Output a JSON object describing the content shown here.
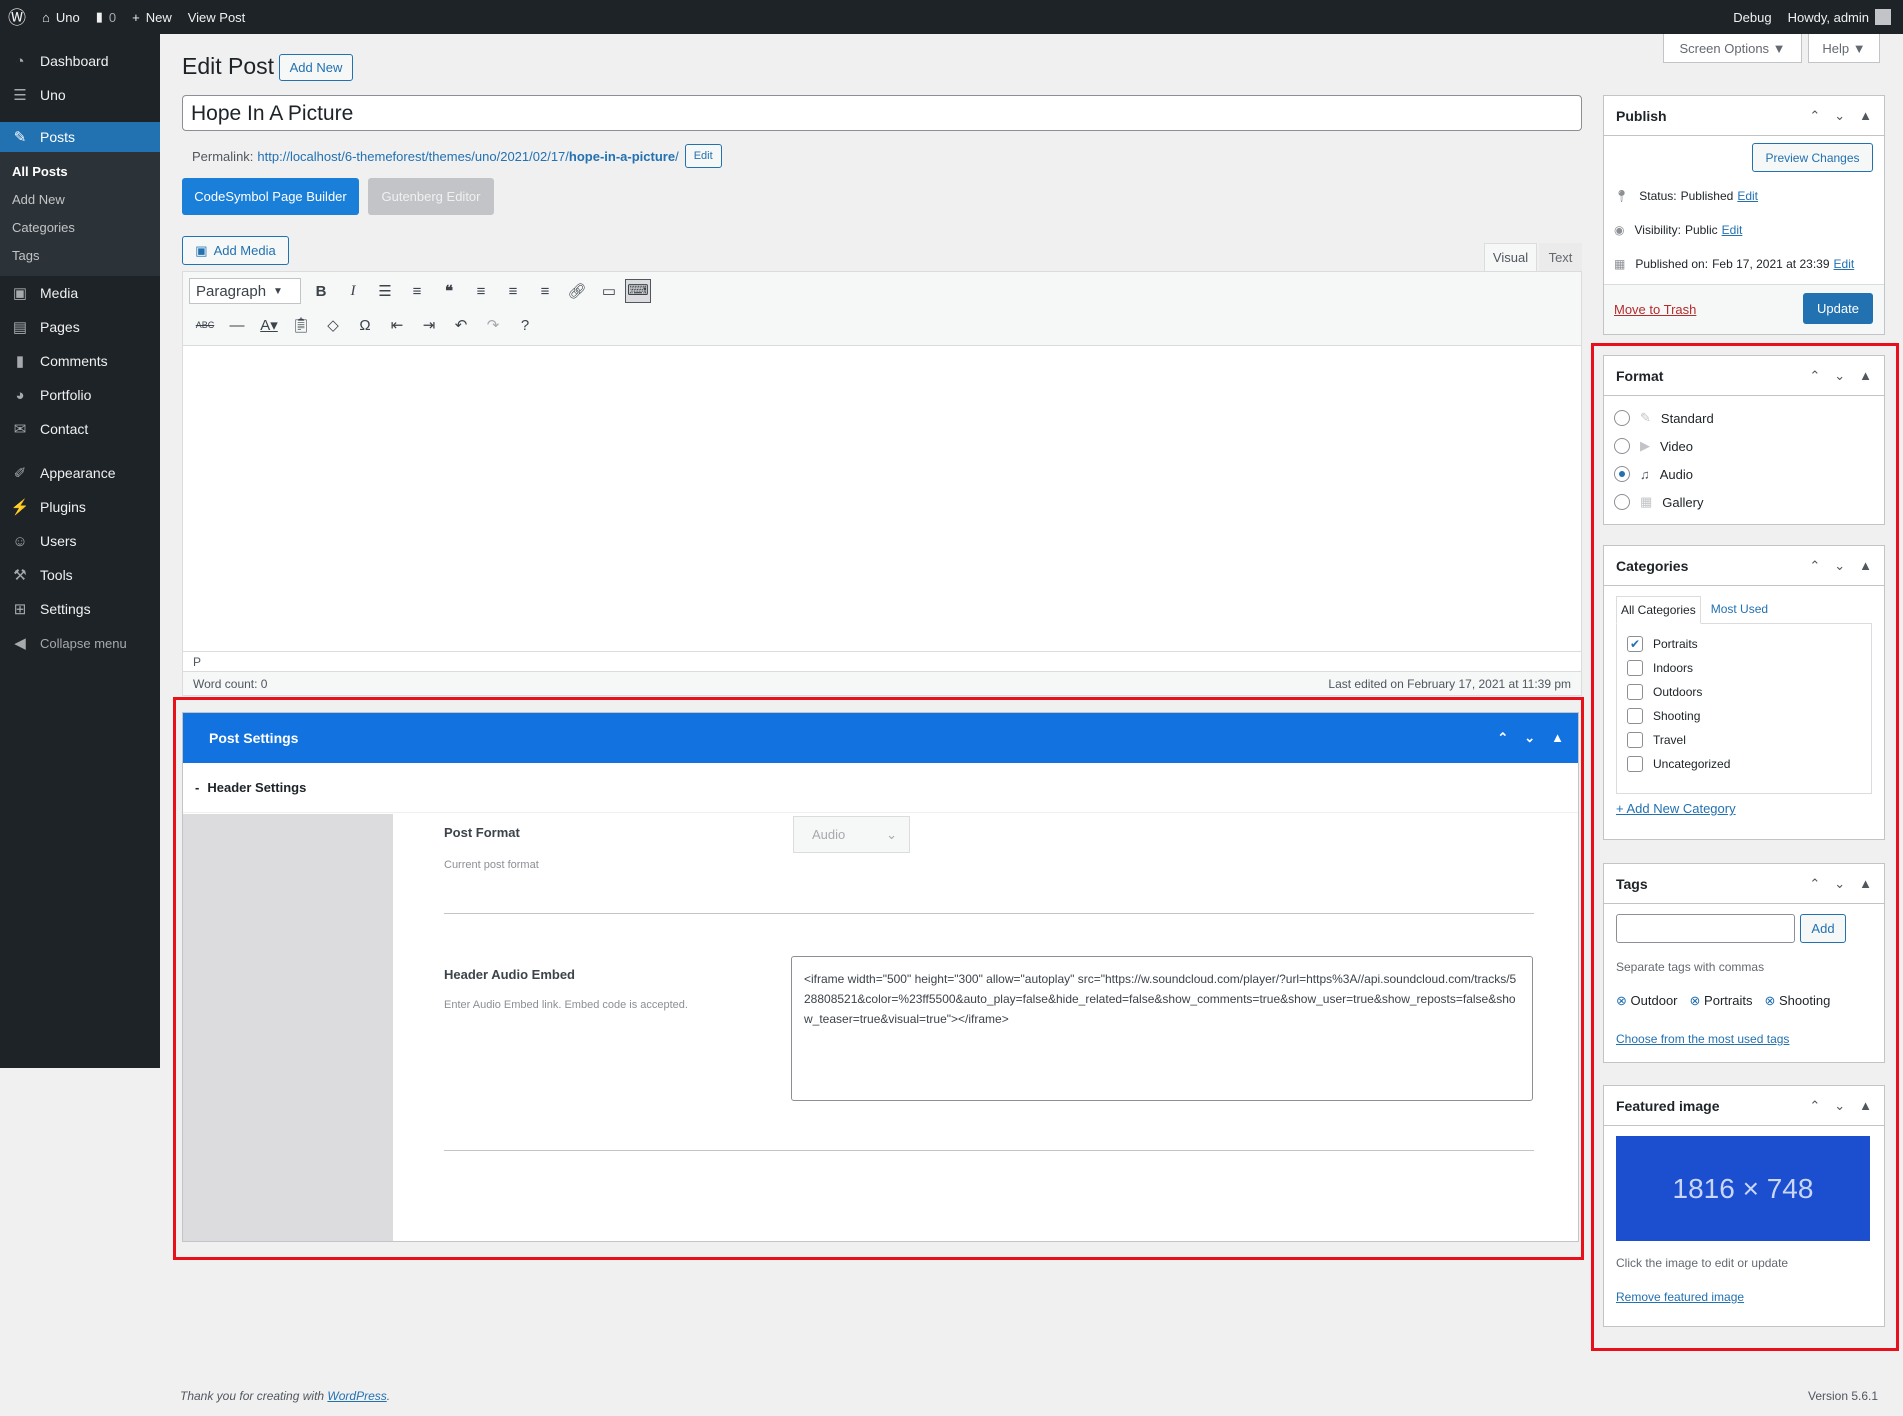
{
  "adminbar": {
    "site": "Uno",
    "comments": "0",
    "new": "New",
    "view": "View Post",
    "debug": "Debug",
    "howdy": "Howdy, admin"
  },
  "menu": {
    "items": [
      {
        "label": "Dashboard",
        "icon": "dashboard-icon"
      },
      {
        "label": "Uno",
        "icon": "uno-icon"
      },
      {
        "label": "Posts",
        "icon": "pin-icon"
      }
    ],
    "sub": [
      "All Posts",
      "Add New",
      "Categories",
      "Tags"
    ],
    "items2": [
      {
        "label": "Media"
      },
      {
        "label": "Pages"
      },
      {
        "label": "Comments"
      },
      {
        "label": "Portfolio"
      },
      {
        "label": "Contact"
      }
    ],
    "items3": [
      {
        "label": "Appearance"
      },
      {
        "label": "Plugins"
      },
      {
        "label": "Users"
      },
      {
        "label": "Tools"
      },
      {
        "label": "Settings"
      }
    ],
    "collapse": "Collapse menu"
  },
  "top": {
    "screen_options": "Screen Options ▼",
    "help": "Help ▼"
  },
  "page": {
    "title": "Edit Post",
    "add_new": "Add New"
  },
  "post": {
    "title": "Hope In A Picture",
    "permalink_label": "Permalink:",
    "permalink_base": "http://localhost/6-themeforest/themes/uno/2021/02/17/",
    "permalink_slug": "hope-in-a-picture",
    "permalink_tail": "/",
    "edit": "Edit"
  },
  "builders": {
    "codesymbol": "CodeSymbol Page Builder",
    "gutenberg": "Gutenberg Editor"
  },
  "editor": {
    "add_media": "Add Media",
    "tab_visual": "Visual",
    "tab_text": "Text",
    "format": "Paragraph",
    "path": "P",
    "word_count": "Word count: 0",
    "last_edited": "Last edited on February 17, 2021 at 11:39 pm"
  },
  "post_settings": {
    "title": "Post Settings",
    "header_settings": "Header Settings",
    "post_format_label": "Post Format",
    "post_format_desc": "Current post format",
    "post_format_value": "Audio",
    "audio_label": "Header Audio Embed",
    "audio_desc": "Enter Audio Embed link. Embed code is accepted.",
    "audio_value": "<iframe width=\"500\" height=\"300\" allow=\"autoplay\" src=\"https://w.soundcloud.com/player/?url=https%3A//api.soundcloud.com/tracks/528808521&color=%23ff5500&auto_play=false&hide_related=false&show_comments=true&show_user=true&show_reposts=false&show_teaser=true&visual=true\"></iframe>"
  },
  "publish": {
    "title": "Publish",
    "preview": "Preview Changes",
    "status_label": "Status:",
    "status": "Published",
    "visibility_label": "Visibility:",
    "visibility": "Public",
    "published_label": "Published on:",
    "published": "Feb 17, 2021 at 23:39",
    "edit": "Edit",
    "trash": "Move to Trash",
    "update": "Update"
  },
  "format": {
    "title": "Format",
    "options": [
      "Standard",
      "Video",
      "Audio",
      "Gallery"
    ],
    "selected": "Audio"
  },
  "categories": {
    "title": "Categories",
    "tab_all": "All Categories",
    "tab_most": "Most Used",
    "items": [
      {
        "label": "Portraits",
        "checked": true
      },
      {
        "label": "Indoors",
        "checked": false
      },
      {
        "label": "Outdoors",
        "checked": false
      },
      {
        "label": "Shooting",
        "checked": false
      },
      {
        "label": "Travel",
        "checked": false
      },
      {
        "label": "Uncategorized",
        "checked": false
      }
    ],
    "add": "+ Add New Category"
  },
  "tags": {
    "title": "Tags",
    "add": "Add",
    "hint": "Separate tags with commas",
    "items": [
      "Outdoor",
      "Portraits",
      "Shooting"
    ],
    "choose": "Choose from the most used tags"
  },
  "featured": {
    "title": "Featured image",
    "placeholder": "1816 × 748",
    "hint": "Click the image to edit or update",
    "remove": "Remove featured image"
  },
  "footer": {
    "thanks": "Thank you for creating with ",
    "wp": "WordPress",
    "period": ".",
    "version": "Version 5.6.1"
  },
  "colors": {
    "accent": "#2271b1",
    "postsettings": "#1272e0",
    "highlight": "#e8101a",
    "featured": "#1b4fd0"
  }
}
